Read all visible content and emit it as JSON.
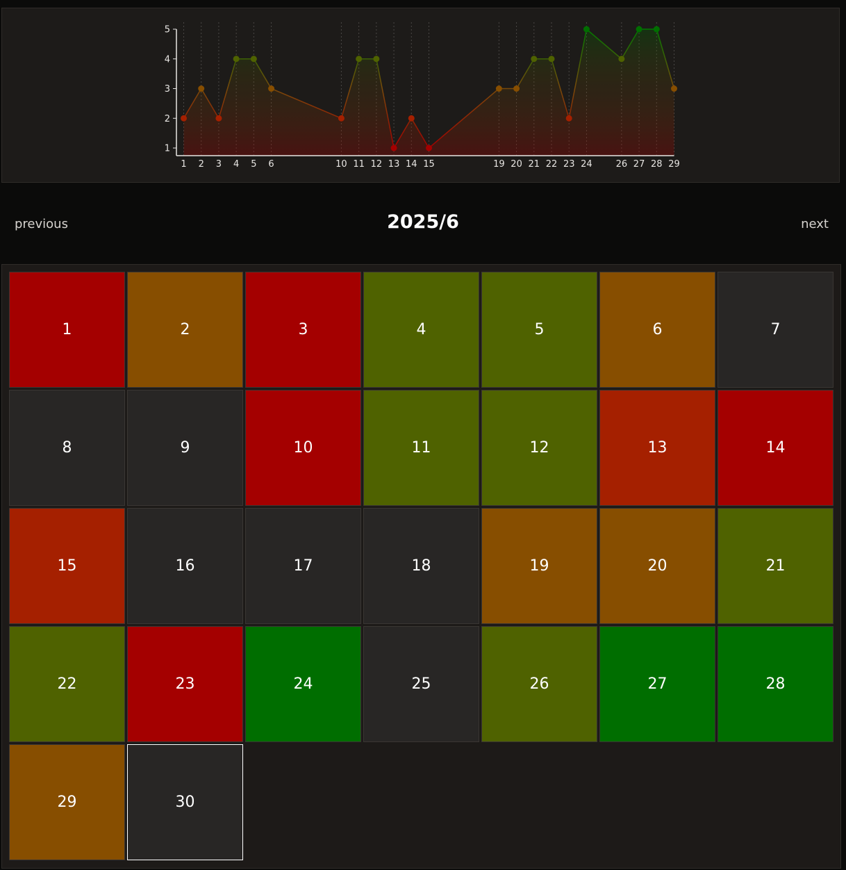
{
  "nav": {
    "previous_label": "previous",
    "title": "2025/6",
    "next_label": "next"
  },
  "colors": {
    "1": "#a52000",
    "2": "#a40000",
    "3": "#874e00",
    "4": "#4f6200",
    "5": "#006e00",
    "empty": "#282625"
  },
  "chart_data": {
    "type": "line",
    "x": [
      1,
      2,
      3,
      4,
      5,
      6,
      10,
      11,
      12,
      13,
      14,
      15,
      19,
      20,
      21,
      22,
      23,
      24,
      26,
      27,
      28,
      29
    ],
    "y": [
      2,
      3,
      2,
      4,
      4,
      3,
      2,
      4,
      4,
      1,
      2,
      1,
      3,
      3,
      4,
      4,
      2,
      5,
      4,
      5,
      5,
      3
    ],
    "xlim": [
      1,
      29
    ],
    "ylim": [
      1,
      5
    ],
    "yticks": [
      1,
      2,
      3,
      4,
      5
    ],
    "xlabel": "",
    "ylabel": "",
    "title": "",
    "grid": "vertical dotted lines at data points",
    "point_colors": {
      "1": "#a40000",
      "2": "#a52000",
      "3": "#874e00",
      "4": "#4f6200",
      "5": "#006e00"
    }
  },
  "calendar": {
    "days": [
      {
        "day": "1",
        "rating": 2
      },
      {
        "day": "2",
        "rating": 3
      },
      {
        "day": "3",
        "rating": 2
      },
      {
        "day": "4",
        "rating": 4
      },
      {
        "day": "5",
        "rating": 4
      },
      {
        "day": "6",
        "rating": 3
      },
      {
        "day": "7",
        "rating": null
      },
      {
        "day": "8",
        "rating": null
      },
      {
        "day": "9",
        "rating": null
      },
      {
        "day": "10",
        "rating": 2
      },
      {
        "day": "11",
        "rating": 4
      },
      {
        "day": "12",
        "rating": 4
      },
      {
        "day": "13",
        "rating": 1
      },
      {
        "day": "14",
        "rating": 2
      },
      {
        "day": "15",
        "rating": 1
      },
      {
        "day": "16",
        "rating": null
      },
      {
        "day": "17",
        "rating": null
      },
      {
        "day": "18",
        "rating": null
      },
      {
        "day": "19",
        "rating": 3
      },
      {
        "day": "20",
        "rating": 3
      },
      {
        "day": "21",
        "rating": 4
      },
      {
        "day": "22",
        "rating": 4
      },
      {
        "day": "23",
        "rating": 2
      },
      {
        "day": "24",
        "rating": 5
      },
      {
        "day": "25",
        "rating": null
      },
      {
        "day": "26",
        "rating": 4
      },
      {
        "day": "27",
        "rating": 5
      },
      {
        "day": "28",
        "rating": 5
      },
      {
        "day": "29",
        "rating": 3
      },
      {
        "day": "30",
        "rating": null,
        "today": true
      }
    ]
  }
}
